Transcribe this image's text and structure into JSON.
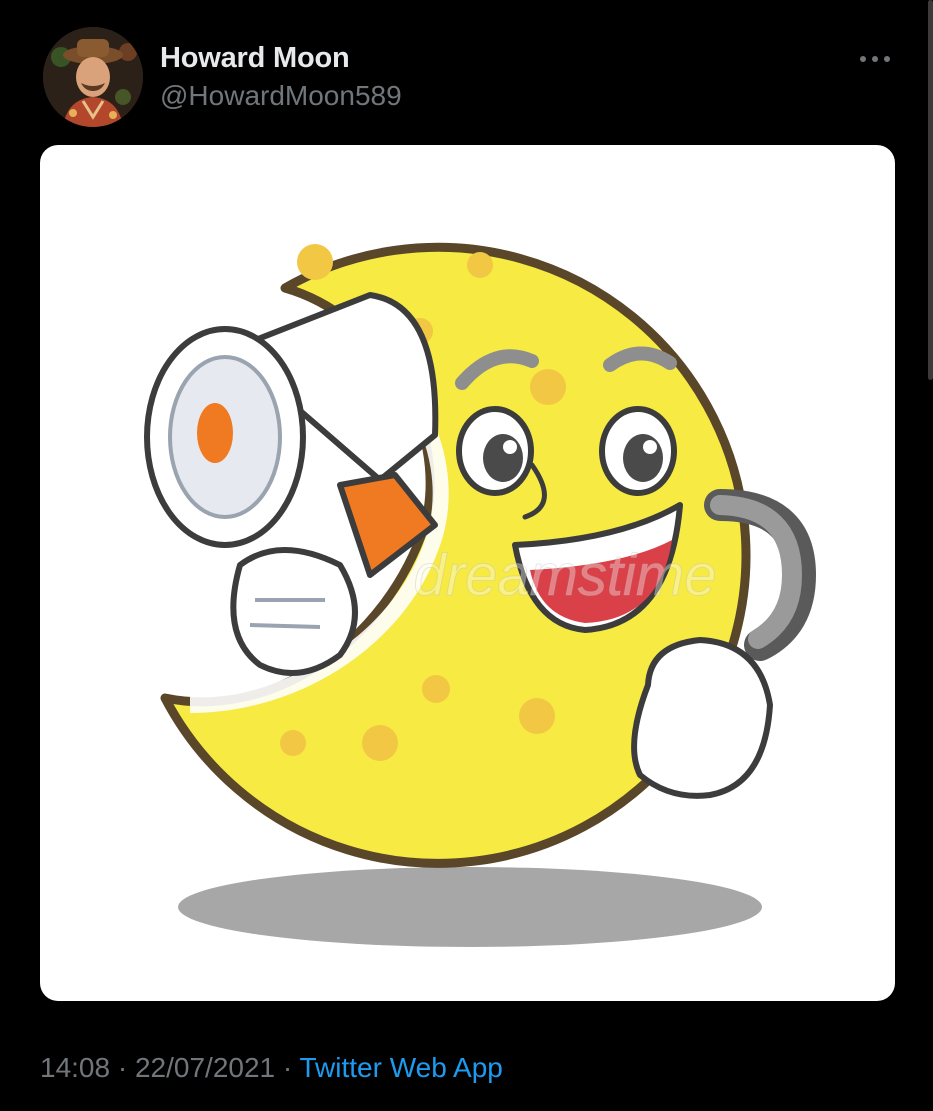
{
  "colors": {
    "background": "#000000",
    "name_text": "#e7e9ea",
    "secondary_text": "#71767b",
    "link": "#1d9bf0",
    "media_background": "#ffffff"
  },
  "author": {
    "display_name": "Howard Moon",
    "handle": "@HowardMoon589",
    "avatar_icon": "user-avatar"
  },
  "more_icon": "ellipsis-icon",
  "media": {
    "kind": "cartoon-illustration",
    "watermark": "dreamstime"
  },
  "meta": {
    "time": "14:08",
    "separator": " · ",
    "date": "22/07/2021",
    "source": "Twitter Web App"
  }
}
